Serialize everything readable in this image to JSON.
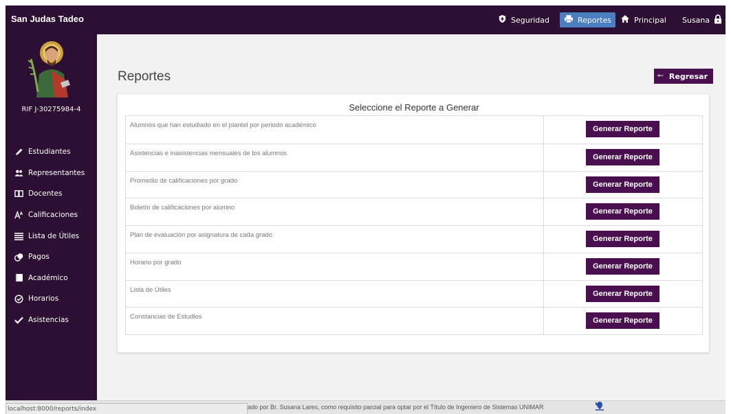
{
  "header": {
    "brand": "San Judas Tadeo",
    "nav": [
      {
        "label": "Seguridad",
        "icon": "shield-icon"
      },
      {
        "label": "Reportes",
        "icon": "printer-icon"
      },
      {
        "label": "Principal",
        "icon": "home-icon"
      },
      {
        "label": "Susana",
        "icon": "lock-icon"
      }
    ]
  },
  "sidebar": {
    "rif": "RIF J-30275984-4",
    "items": [
      {
        "label": "Estudiantes",
        "icon": "pencil-icon"
      },
      {
        "label": "Representantes",
        "icon": "users-icon"
      },
      {
        "label": "Docentes",
        "icon": "book-icon"
      },
      {
        "label": "Calificaciones",
        "icon": "font-size-icon"
      },
      {
        "label": "Lista de Útiles",
        "icon": "list-icon"
      },
      {
        "label": "Pagos",
        "icon": "coins-icon"
      },
      {
        "label": "Académico",
        "icon": "notebook-icon"
      },
      {
        "label": "Horarios",
        "icon": "clock-icon"
      },
      {
        "label": "Asistencias",
        "icon": "check-icon"
      }
    ]
  },
  "main": {
    "title": "Reportes",
    "back_label": "Regresar",
    "panel_title": "Seleccione el Reporte a Generar",
    "button_label": "Generar Reporte",
    "reports": [
      "Alumnos que han estudiado en el plantel por periodo académico",
      "Asistencias e inasistencias mensuales de los alumnos",
      "Promedio de calificaciones por grado",
      "Boletín de calificaciones por alumno",
      "Plan de evaluación por asignatura de cada grado",
      "Horario por grado",
      "Lista de Útiles",
      "Constancias de Estudios"
    ]
  },
  "footer": {
    "status_url": "localhost:8000/reports/index",
    "text": "ado por Br. Susana Lares, como requisito parcial para optar por el Título de Ingeniero de Sistemas UNIMAR"
  },
  "colors": {
    "dark_purple": "#2c0f33",
    "button_purple": "#4a0f4f",
    "active_nav": "#4a7fc1"
  }
}
